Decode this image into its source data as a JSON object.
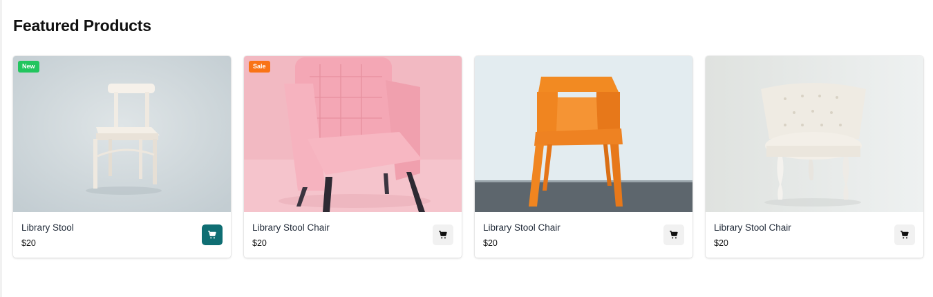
{
  "section": {
    "title": "Featured Products"
  },
  "products": [
    {
      "name": "Library Stool",
      "price": "$20",
      "badge": "New",
      "image_icon": "white-wooden-chair",
      "cart_icon": "shopping-cart-icon",
      "cart_active": true
    },
    {
      "name": "Library Stool Chair",
      "price": "$20",
      "badge": "Sale",
      "image_icon": "pink-armchair",
      "cart_icon": "shopping-cart-icon",
      "cart_active": false
    },
    {
      "name": "Library Stool Chair",
      "price": "$20",
      "badge": "",
      "image_icon": "orange-plastic-chair",
      "cart_icon": "shopping-cart-icon",
      "cart_active": false
    },
    {
      "name": "Library Stool Chair",
      "price": "$20",
      "badge": "",
      "image_icon": "white-tufted-chair",
      "cart_icon": "shopping-cart-icon",
      "cart_active": false
    }
  ],
  "colors": {
    "new_badge": "#22c55e",
    "sale_badge": "#f97316",
    "cart_active": "#0f6e73",
    "cart_default": "#f1f1f1"
  }
}
